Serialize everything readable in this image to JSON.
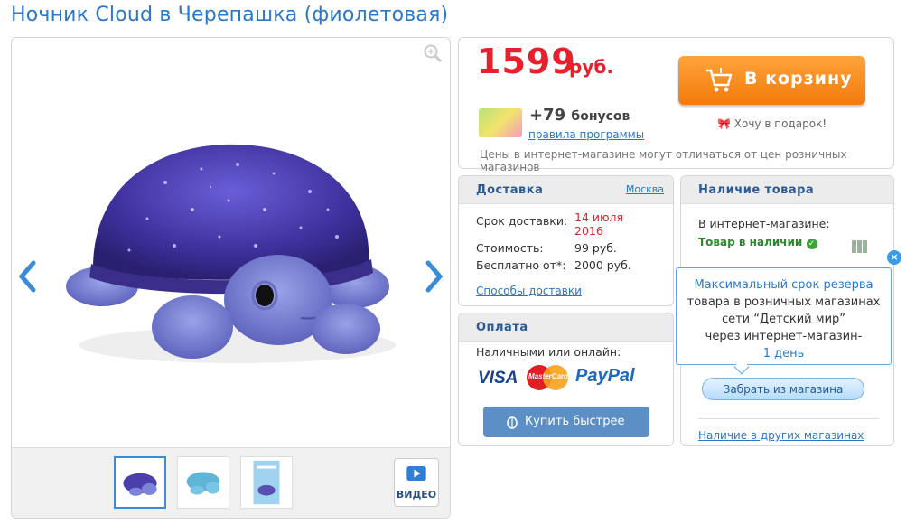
{
  "product": {
    "title": "Ночник Cloud в Черепашка (фиолетовая)"
  },
  "gallery": {
    "video_label": "ВИДЕО",
    "thumbnails": [
      "turtle-purple-1",
      "turtle-blue",
      "box-package"
    ],
    "selected_thumbnail": 0
  },
  "price": {
    "amount": "1599",
    "currency": "руб.",
    "cart_button": "В корзину",
    "gift_link": "Хочу в подарок!",
    "bonus_text": "+79",
    "bonus_word": "бонусов",
    "bonus_link": "правила программы",
    "note": "Цены в интернет-магазине могут отличаться от цен розничных магазинов"
  },
  "delivery": {
    "title": "Доставка",
    "city": "Москва",
    "rows": [
      {
        "label": "Срок доставки:",
        "value": "14 июля 2016"
      },
      {
        "label": "Стоимость:",
        "value": "99 руб."
      },
      {
        "label": "Бесплатно от*:",
        "value": "2000 руб."
      }
    ],
    "methods_link": "Способы доставки"
  },
  "payment": {
    "title": "Оплата",
    "label": "Наличными или онлайн:",
    "logos": [
      "VISA",
      "MasterCard",
      "PayPal"
    ],
    "buy_fast": "Купить быстрее"
  },
  "stock": {
    "title": "Наличие товара",
    "online_label": "В интернет-магазине:",
    "online_status": "Товар в наличии",
    "pickup_button": "Забрать из магазина",
    "other_stores": "Наличие в других магазинах"
  },
  "popup": {
    "line1": "Максимальный срок резерва",
    "line2": "товара в розничных магазинах",
    "line3": "сети “Детский мир”",
    "line4": "через интернет-магазин-",
    "line5": "1 день"
  },
  "colors": {
    "accent": "#2a78c8",
    "price": "#e8202e",
    "cart": "#f47a0a"
  }
}
